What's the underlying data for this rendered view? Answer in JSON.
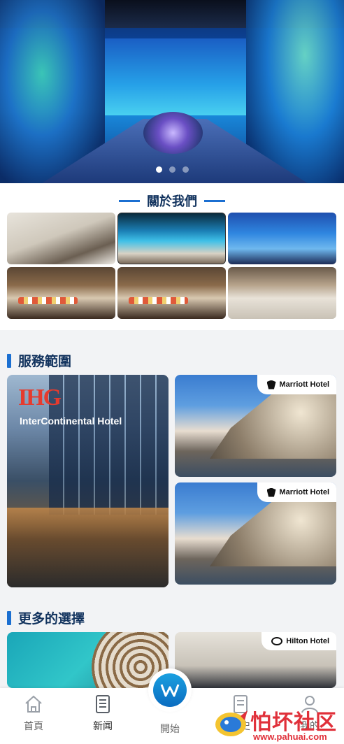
{
  "hero": {
    "slides": 3,
    "active_slide": 0
  },
  "about": {
    "title": "關於我們"
  },
  "services": {
    "title": "服務範圍",
    "ihg": {
      "logo": "IHG",
      "name": "InterContinental Hotel"
    },
    "marriott_1": {
      "badge": "Marriott Hotel"
    },
    "marriott_2": {
      "badge": "Marriott Hotel"
    }
  },
  "more": {
    "title": "更多的選擇",
    "hilton": {
      "badge": "Hilton Hotel"
    }
  },
  "nav": {
    "items": [
      {
        "label": "首頁",
        "icon": "home-icon"
      },
      {
        "label": "新闻",
        "icon": "news-icon"
      },
      {
        "label": "開始",
        "icon": "start-icon"
      },
      {
        "label": "歷史",
        "icon": "history-icon"
      },
      {
        "label": "我的",
        "icon": "profile-icon"
      }
    ],
    "active": "新闻"
  },
  "watermark": {
    "text": "怕坏社区",
    "url": "www.pahuai.com"
  },
  "colors": {
    "accent": "#1b6fd1",
    "heading": "#12335e",
    "ihg_red": "#e63b2e",
    "watermark_red": "#e0303a"
  }
}
